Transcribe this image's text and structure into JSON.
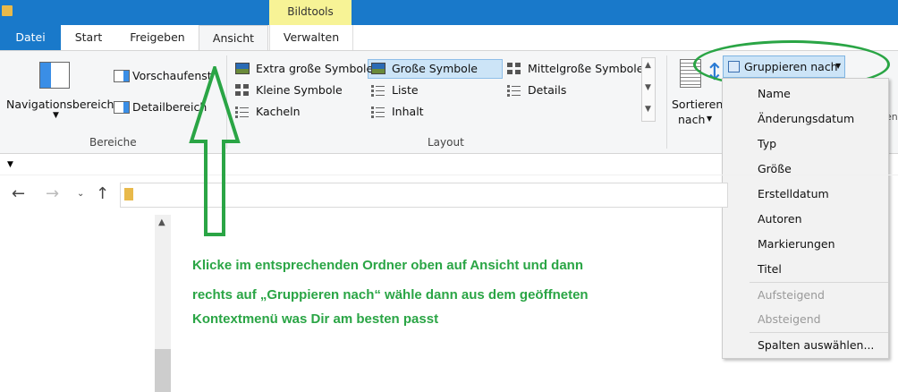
{
  "titlebar": {
    "context_tab": "Bildtools"
  },
  "tabs": [
    {
      "label": "Datei"
    },
    {
      "label": "Start"
    },
    {
      "label": "Freigeben"
    },
    {
      "label": "Ansicht"
    },
    {
      "label": "Verwalten"
    }
  ],
  "ribbon": {
    "bereiche": {
      "navigation_pane": "Navigationsbereich",
      "preview_pane": "Vorschaufenster",
      "details_pane": "Detailbereich",
      "group_label": "Bereiche"
    },
    "layout": {
      "items": [
        "Extra große Symbole",
        "Große Symbole",
        "Mittelgroße Symbole",
        "Kleine Symbole",
        "Liste",
        "Details",
        "Kacheln",
        "Inhalt"
      ],
      "group_label": "Layout",
      "selected": "Große Symbole"
    },
    "current_view": {
      "sort_line1": "Sortieren",
      "sort_line2": "nach",
      "group_by": "Gruppieren nach",
      "edge_text": "en"
    }
  },
  "group_menu": {
    "items": [
      "Name",
      "Änderungsdatum",
      "Typ",
      "Größe",
      "Erstelldatum",
      "Autoren",
      "Markierungen",
      "Titel"
    ],
    "order": [
      "Aufsteigend",
      "Absteigend"
    ],
    "choose_columns": "Spalten auswählen..."
  },
  "instructions": [
    "Klicke im entsprechenden Ordner oben auf Ansicht und dann",
    "rechts auf „Gruppieren nach“ wähle dann aus dem geöffneten",
    "Kontextmenü was Dir am besten passt"
  ],
  "colors": {
    "accent": "#1979ca",
    "context_tab": "#f7f396",
    "highlight_green": "#2aa545",
    "selection": "#cce4f7"
  }
}
